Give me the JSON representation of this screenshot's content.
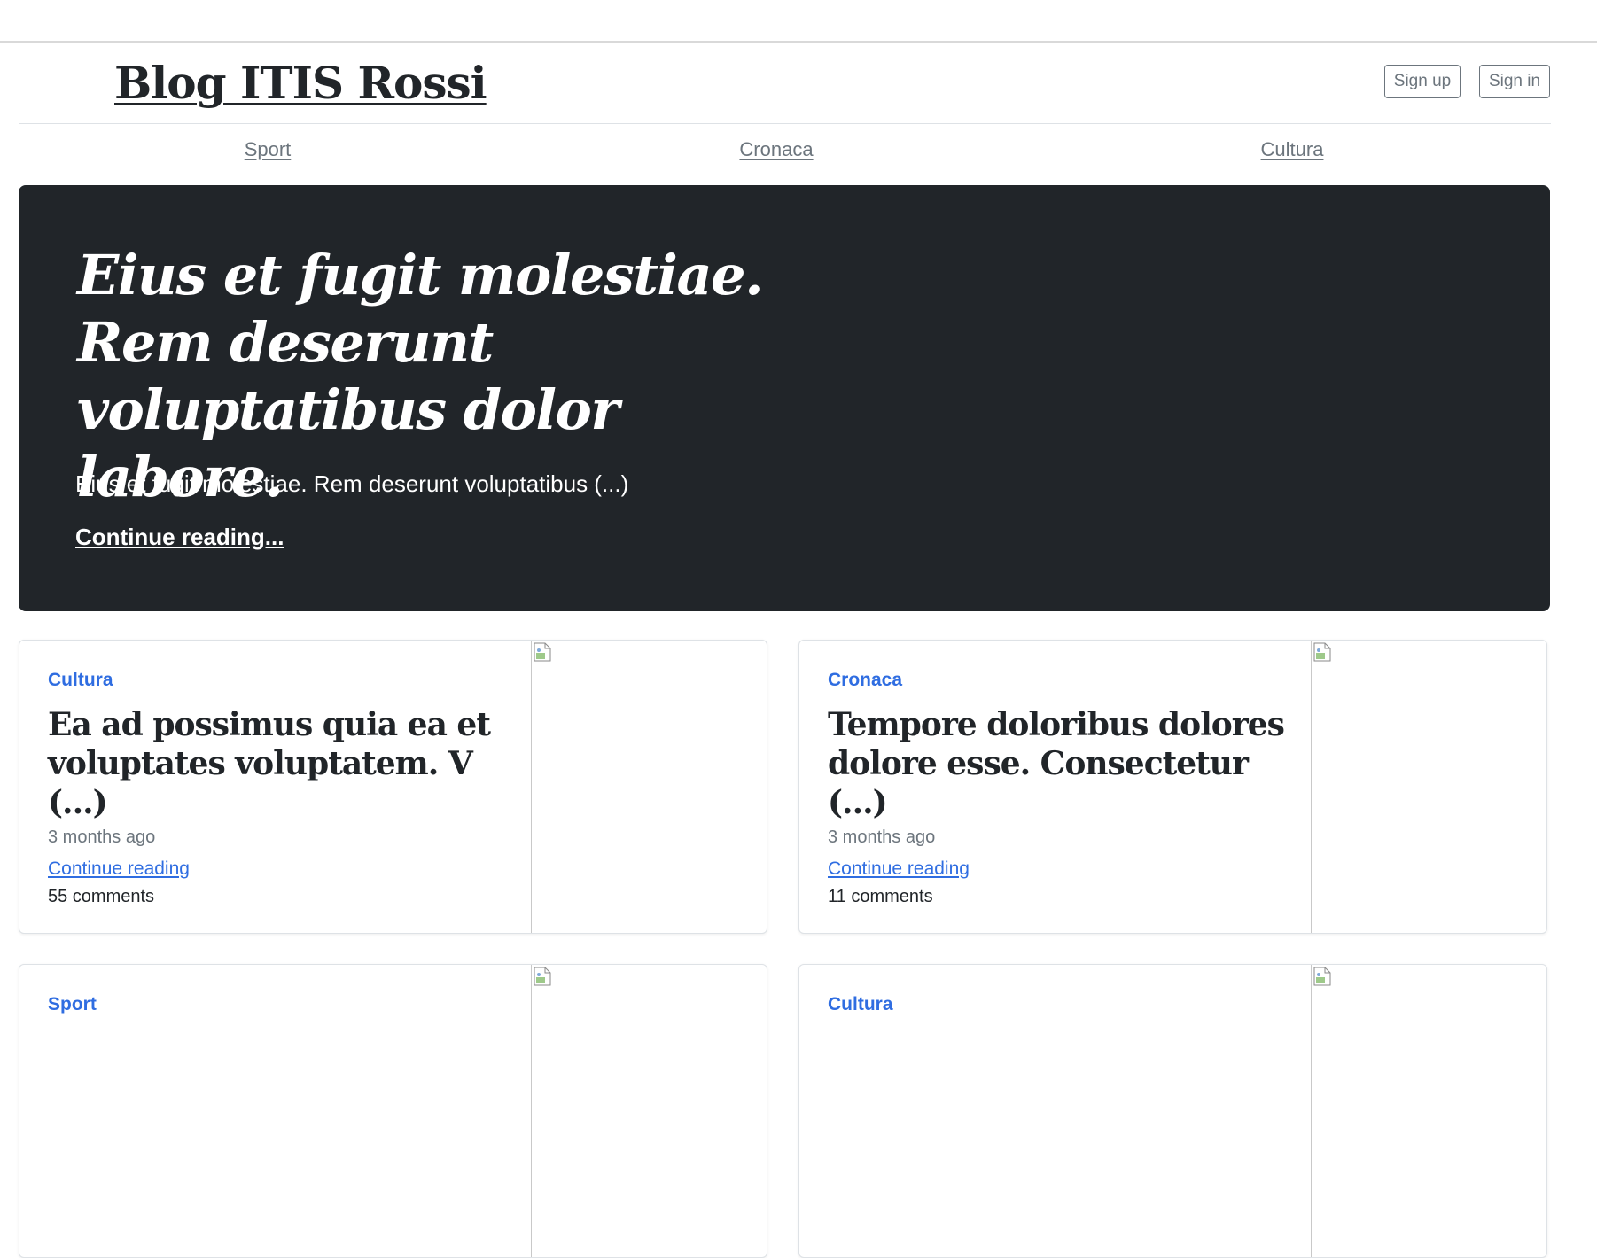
{
  "header": {
    "brand": "Blog ITIS Rossi",
    "signup_label": "Sign up",
    "signin_label": "Sign in"
  },
  "nav": {
    "items": [
      {
        "label": "Sport"
      },
      {
        "label": "Cronaca"
      },
      {
        "label": "Cultura"
      }
    ]
  },
  "hero": {
    "title": "Eius et fugit molestiae. Rem deserunt voluptatibus dolor labore.",
    "lead": "Eius et fugit molestiae. Rem deserunt voluptatibus (...)",
    "link_label": "Continue reading..."
  },
  "posts": [
    {
      "category": "Cultura",
      "title": "Ea ad possimus quia ea et voluptates voluptatem. V (...)",
      "date": "3 months ago",
      "link_label": "Continue reading",
      "comments": "55 comments"
    },
    {
      "category": "Cronaca",
      "title": "Tempore doloribus dolores dolore esse. Consectetur (...)",
      "date": "3 months ago",
      "link_label": "Continue reading",
      "comments": "11 comments"
    },
    {
      "category": "Sport"
    },
    {
      "category": "Cultura"
    }
  ],
  "colors": {
    "hero_bg": "#212529",
    "accent_link": "#2f6de1",
    "muted": "#6c757d"
  }
}
